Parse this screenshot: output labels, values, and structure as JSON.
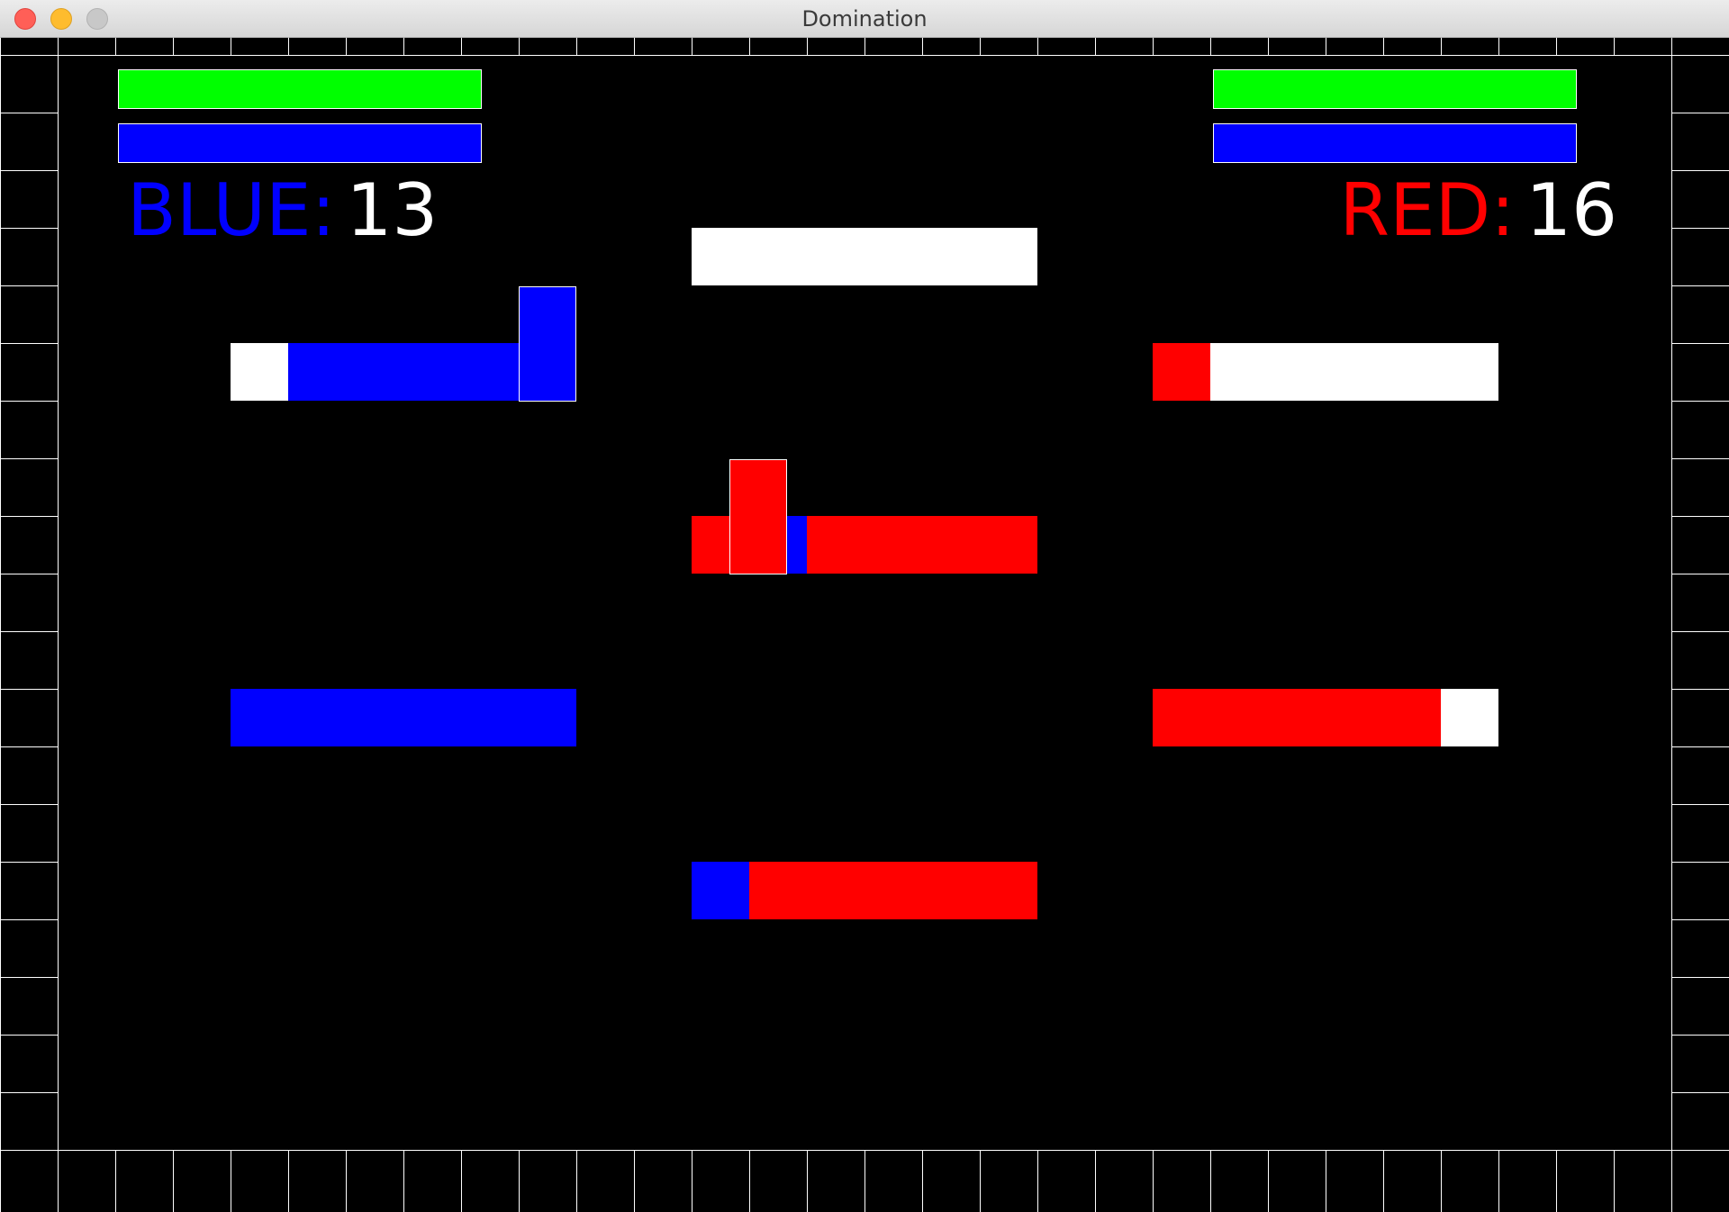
{
  "window": {
    "title": "Domination"
  },
  "colors": {
    "blue": "#0000ff",
    "red": "#ff0000",
    "neutral": "#ffffff",
    "health": "#00ff00",
    "background": "#000000",
    "grid": "#ffffff"
  },
  "hud": {
    "blue_player": {
      "label": "BLUE:",
      "score": "13",
      "health_level": 1.0,
      "energy_level": 1.0
    },
    "red_player": {
      "label": "RED:",
      "score": "16",
      "health_level": 1.0,
      "energy_level": 1.0
    }
  },
  "platforms": [
    {
      "name": "top-center",
      "segments": [
        "neutral",
        "neutral",
        "neutral",
        "neutral",
        "neutral",
        "neutral"
      ]
    },
    {
      "name": "upper-left",
      "segments": [
        "neutral",
        "blue",
        "blue",
        "blue",
        "blue",
        "blue"
      ]
    },
    {
      "name": "upper-right",
      "segments": [
        "red",
        "neutral",
        "neutral",
        "neutral",
        "neutral",
        "neutral"
      ]
    },
    {
      "name": "middle-center",
      "segments": [
        "red",
        "blue",
        "red",
        "red",
        "red",
        "red"
      ]
    },
    {
      "name": "lower-left",
      "segments": [
        "blue",
        "blue",
        "blue",
        "blue",
        "blue",
        "blue"
      ]
    },
    {
      "name": "lower-right",
      "segments": [
        "red",
        "red",
        "red",
        "red",
        "red",
        "neutral"
      ]
    },
    {
      "name": "bottom-center",
      "segments": [
        "blue",
        "red",
        "red",
        "red",
        "red",
        "red"
      ]
    }
  ],
  "players": [
    {
      "name": "blue-player",
      "team": "blue"
    },
    {
      "name": "red-player",
      "team": "red"
    }
  ]
}
